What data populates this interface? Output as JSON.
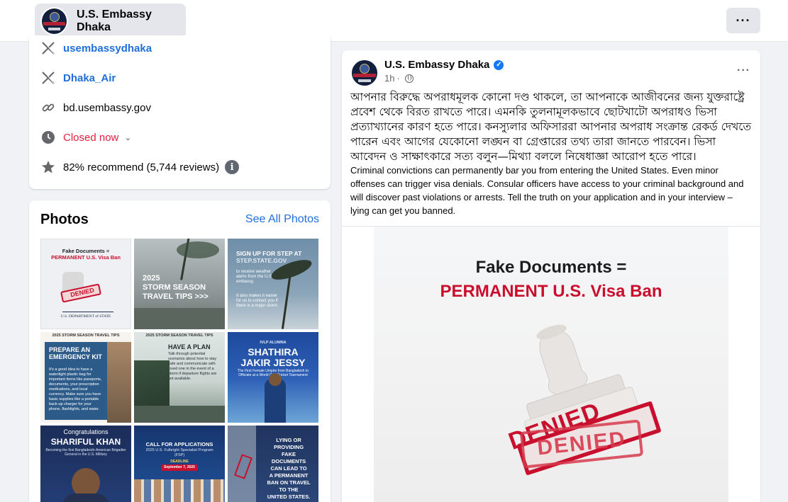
{
  "header": {
    "page_name": "U.S. Embassy Dhaka",
    "avatar_caption": "Bangladesh",
    "more_label": "···"
  },
  "intro": {
    "items": [
      {
        "icon": "x-logo-icon",
        "text": "usembassydhaka",
        "style": "link"
      },
      {
        "icon": "x-logo-icon",
        "text": "Dhaka_Air",
        "style": "link"
      },
      {
        "icon": "link-icon",
        "text": "bd.usembassy.gov",
        "style": "plain"
      },
      {
        "icon": "clock-icon",
        "text": "Closed now",
        "style": "closed"
      },
      {
        "icon": "star-icon",
        "text": "82% recommend (5,744 reviews)",
        "style": "plain"
      }
    ]
  },
  "photos": {
    "title": "Photos",
    "see_all": "See All Photos",
    "thumbs": [
      {
        "lines": [
          "Fake Documents =",
          "PERMANENT U.S. Visa Ban",
          "DENIED",
          "U.S. DEPARTMENT of STATE"
        ]
      },
      {
        "lines": [
          "2025",
          "STORM SEASON",
          "TRAVEL TIPS >>>"
        ]
      },
      {
        "lines": [
          "SIGN UP FOR STEP AT",
          "STEP.STATE.GOV",
          "to receive weather alerts from the U.S. embassy.",
          "It also makes it easier for us to contact you if there is a major storm."
        ]
      },
      {
        "lines": [
          "2025 STORM SEASON TRAVEL TIPS",
          "PREPARE AN EMERGENCY KIT",
          "It's a good idea to have a watertight plastic bag for important items like passports, documents, your prescription medications, and local currency. Make sure you have basic supplies like a portable back-up charger for your phone, flashlights, and water."
        ]
      },
      {
        "lines": [
          "2025 STORM SEASON TRAVEL TIPS",
          "HAVE A PLAN",
          "Talk through potential scenarios about how to stay safe and communicate with loved one in the event of a storm if departure flights are not available."
        ]
      },
      {
        "lines": [
          "IVLP ALUMNA",
          "SHATHIRA",
          "JAKIR JESSY",
          "The First Female Umpire from Bangladesh to Officiate at a World Cup Cricket Tournament"
        ]
      },
      {
        "lines": [
          "Congratulations",
          "SHARIFUL KHAN",
          "Becoming the first Bangladeshi-American Brigadier General in the U.S. Military"
        ]
      },
      {
        "lines": [
          "CALL FOR APPLICATIONS",
          "2025 U.S. Fulbright Specialist Program (FSP)",
          "DEADLINE",
          "September 7, 2025"
        ]
      },
      {
        "lines": [
          "LYING OR",
          "PROVIDING",
          "FAKE",
          "DOCUMENTS",
          "CAN LEAD TO",
          "A PERMANENT",
          "BAN ON TRAVEL",
          "TO THE",
          "UNITED STATES."
        ]
      }
    ]
  },
  "post": {
    "author": "U.S. Embassy Dhaka",
    "time": "1h",
    "more_label": "···",
    "text_bn": "আপনার বিরুদ্ধে অপরাধমূলক কোনো দণ্ড থাকলে, তা আপনাকে আজীবনের জন্য যুক্তরাষ্ট্রে প্রবেশ থেকে বিরত রাখতে পারে। এমনকি তুলনামূলকভাবে ছোটখাটো অপরাধও ভিসা প্রত্যাখ্যানের কারণ হতে পারে। কনস্যুলার অফিসাররা আপনার অপরাধ সংক্রান্ত রেকর্ড দেখতে পারেন এবং আগের যেকোনো লঙ্ঘন বা গ্রেপ্তারের তথ্য তারা জানতে পারবেন। ভিসা আবেদন ও সাক্ষাৎকারে সত্য বলুন—মিথ্যা বললে নিষেধাজ্ঞা আরোপ হতে পারে।",
    "text_en": "Criminal convictions can permanently bar you from entering the United States. Even minor offenses can trigger visa denials. Consular officers have access to your criminal background and will discover past violations or arrests. Tell the truth on your application and in your interview – lying can get you banned.",
    "image": {
      "heading_1": "Fake Documents =",
      "heading_2": "PERMANENT U.S. Visa Ban",
      "stamp_1": "DENIED",
      "stamp_2": "DENIED"
    }
  },
  "colors": {
    "link": "#216fdb",
    "closed": "#e41e3f",
    "brand_navy": "#12203d",
    "denied_red": "#c8102e"
  }
}
